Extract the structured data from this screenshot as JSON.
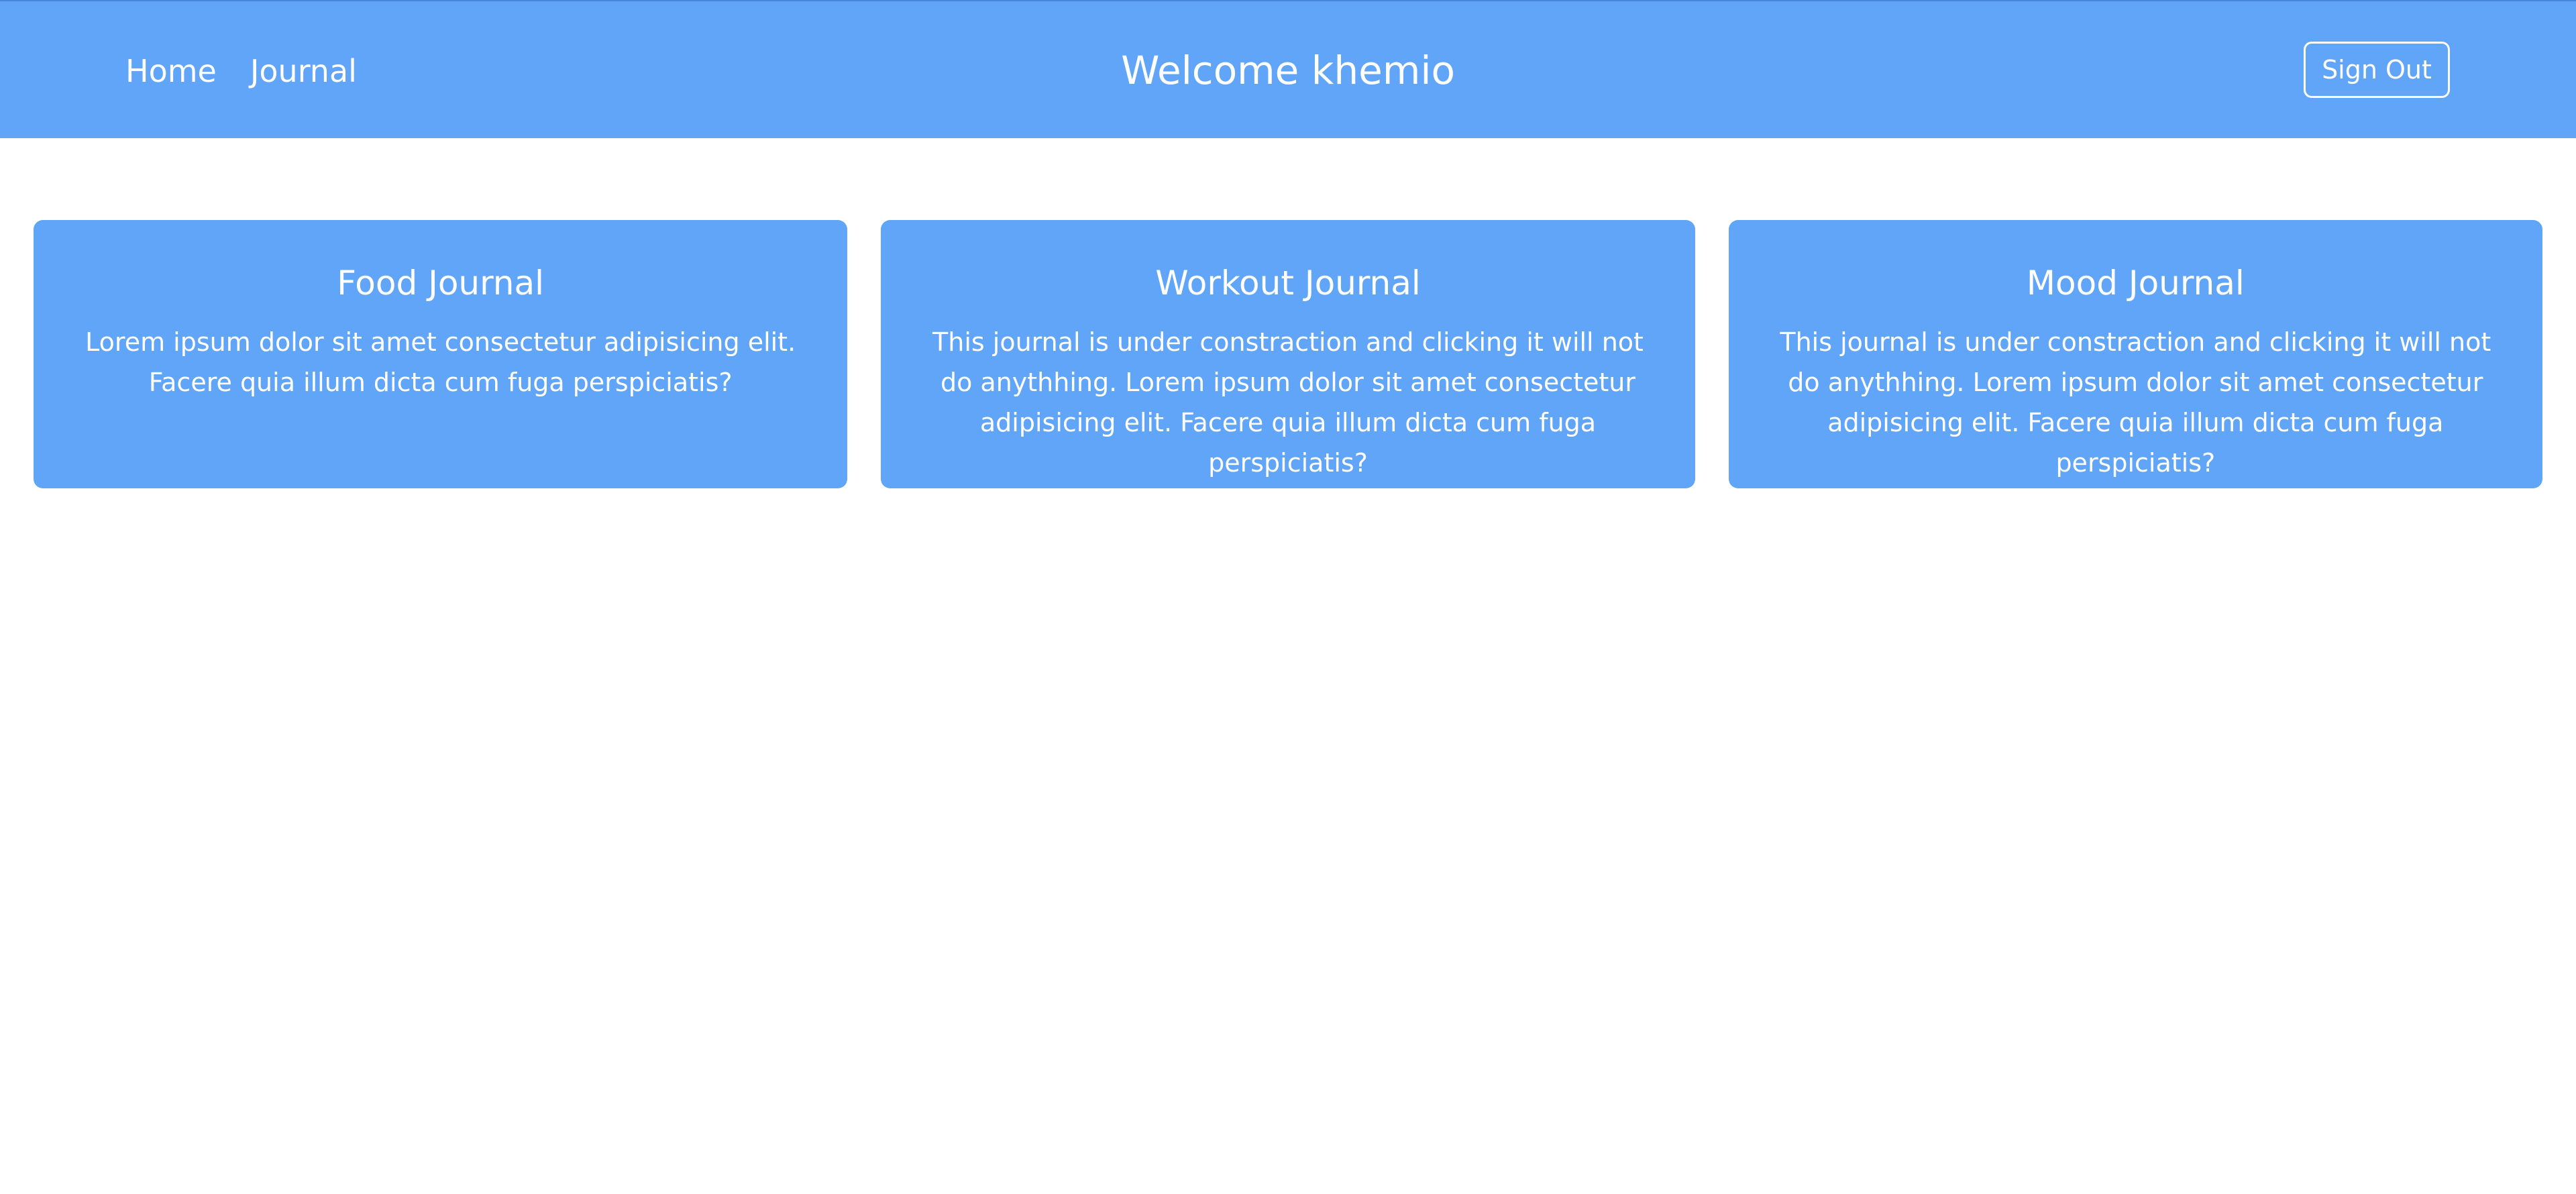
{
  "navbar": {
    "links": [
      {
        "label": "Home"
      },
      {
        "label": "Journal"
      }
    ],
    "title": "Welcome khemio",
    "signout_label": "Sign Out",
    "background_color": "#61a5f8"
  },
  "cards": [
    {
      "title": "Food Journal",
      "text": "Lorem ipsum dolor sit amet consectetur adipisicing elit. Facere quia illum dicta cum fuga perspiciatis?"
    },
    {
      "title": "Workout Journal",
      "text": "This journal is under constraction and clicking it will not do anythhing. Lorem ipsum dolor sit amet consectetur adipisicing elit. Facere quia illum dicta cum fuga perspiciatis?"
    },
    {
      "title": "Mood Journal",
      "text": "This journal is under constraction and clicking it will not do anythhing. Lorem ipsum dolor sit amet consectetur adipisicing elit. Facere quia illum dicta cum fuga perspiciatis?"
    }
  ],
  "colors": {
    "accent": "#61a5f8",
    "text_on_accent": "#ffffff",
    "page_background": "#ffffff"
  }
}
